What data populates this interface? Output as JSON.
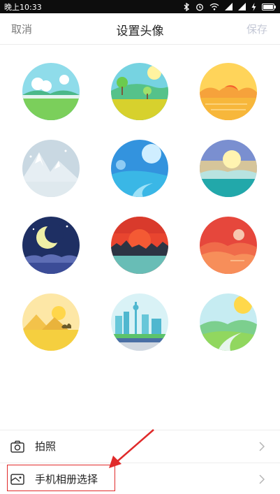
{
  "status_bar": {
    "time": "晚上10:33",
    "background": "#0d0d0d",
    "icons": [
      "bluetooth-icon",
      "alarm-icon",
      "wifi-icon",
      "signal-icon",
      "signal-icon",
      "charging-icon",
      "battery-icon"
    ]
  },
  "nav": {
    "cancel_label": "取消",
    "title": "设置头像",
    "save_label": "保存",
    "save_color": "#c4c8d6"
  },
  "avatars": [
    {
      "name": "green-meadow-day"
    },
    {
      "name": "yellow-field-with-trees"
    },
    {
      "name": "orange-sunset-hills"
    },
    {
      "name": "snowy-mountains"
    },
    {
      "name": "blue-moon-river"
    },
    {
      "name": "lake-at-dusk"
    },
    {
      "name": "crescent-moon-night"
    },
    {
      "name": "red-sunset-lake"
    },
    {
      "name": "red-sunset-hills"
    },
    {
      "name": "desert-with-camel"
    },
    {
      "name": "city-skyline"
    },
    {
      "name": "green-valley-sun"
    }
  ],
  "options": [
    {
      "label": "拍照",
      "icon": "camera-icon"
    },
    {
      "label": "手机相册选择",
      "icon": "photo-album-icon"
    }
  ],
  "annotation": {
    "color": "#e02a2a"
  }
}
